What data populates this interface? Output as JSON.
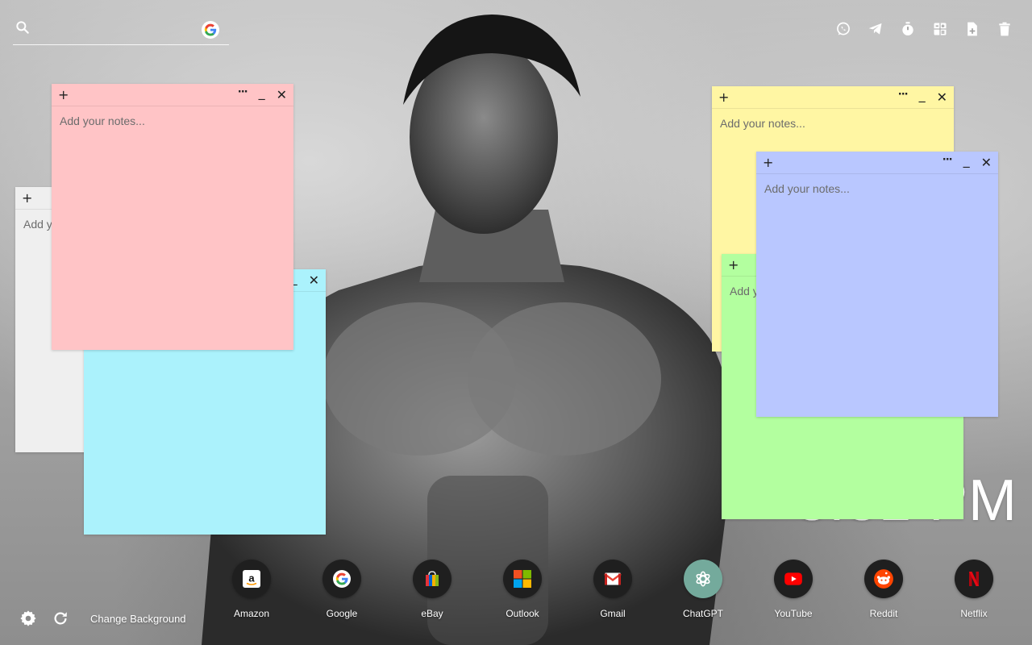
{
  "search": {
    "placeholder": "",
    "value": "",
    "engine_icon": "google-icon"
  },
  "toolbar": [
    {
      "name": "whatsapp-icon"
    },
    {
      "name": "telegram-icon"
    },
    {
      "name": "timer-icon"
    },
    {
      "name": "calculator-icon"
    },
    {
      "name": "new-note-icon"
    },
    {
      "name": "trash-icon"
    }
  ],
  "notes": {
    "placeholder": "Add your notes...",
    "colors": {
      "gray": "#efefef",
      "cyan": "#abf2fc",
      "pink": "#ffc4c6",
      "yellow": "#fff6a3",
      "green": "#b3ff9f",
      "blue": "#b9c7ff"
    },
    "add_label": "+",
    "menu_label": "···",
    "minimize_label": "_",
    "close_label": "✕"
  },
  "clock": {
    "text": "3:31 PM"
  },
  "footer": {
    "change_background": "Change Background"
  },
  "shortcuts": [
    {
      "label": "Amazon",
      "icon": "amazon-icon"
    },
    {
      "label": "Google",
      "icon": "google-icon"
    },
    {
      "label": "eBay",
      "icon": "ebay-icon"
    },
    {
      "label": "Outlook",
      "icon": "outlook-icon"
    },
    {
      "label": "Gmail",
      "icon": "gmail-icon"
    },
    {
      "label": "ChatGPT",
      "icon": "chatgpt-icon"
    },
    {
      "label": "YouTube",
      "icon": "youtube-icon"
    },
    {
      "label": "Reddit",
      "icon": "reddit-icon"
    },
    {
      "label": "Netflix",
      "icon": "netflix-icon"
    }
  ]
}
